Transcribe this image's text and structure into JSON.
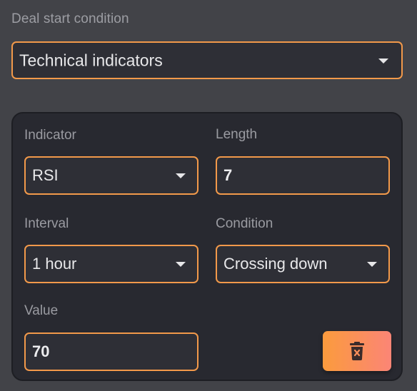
{
  "deal_start": {
    "label": "Deal start condition",
    "selected": "Technical indicators"
  },
  "indicator_card": {
    "indicator": {
      "label": "Indicator",
      "selected": "RSI"
    },
    "length": {
      "label": "Length",
      "value": "7"
    },
    "interval": {
      "label": "Interval",
      "selected": "1 hour"
    },
    "condition": {
      "label": "Condition",
      "selected": "Crossing down"
    },
    "value": {
      "label": "Value",
      "value": "70"
    },
    "delete_button": {
      "icon": "trash-x-icon"
    }
  },
  "colors": {
    "accent_border": "#f2994a",
    "background": "#424348",
    "card_background": "#282930",
    "field_background": "#2e2f36",
    "button_gradient_start": "#fb9b3d",
    "button_gradient_end": "#fb8576"
  }
}
